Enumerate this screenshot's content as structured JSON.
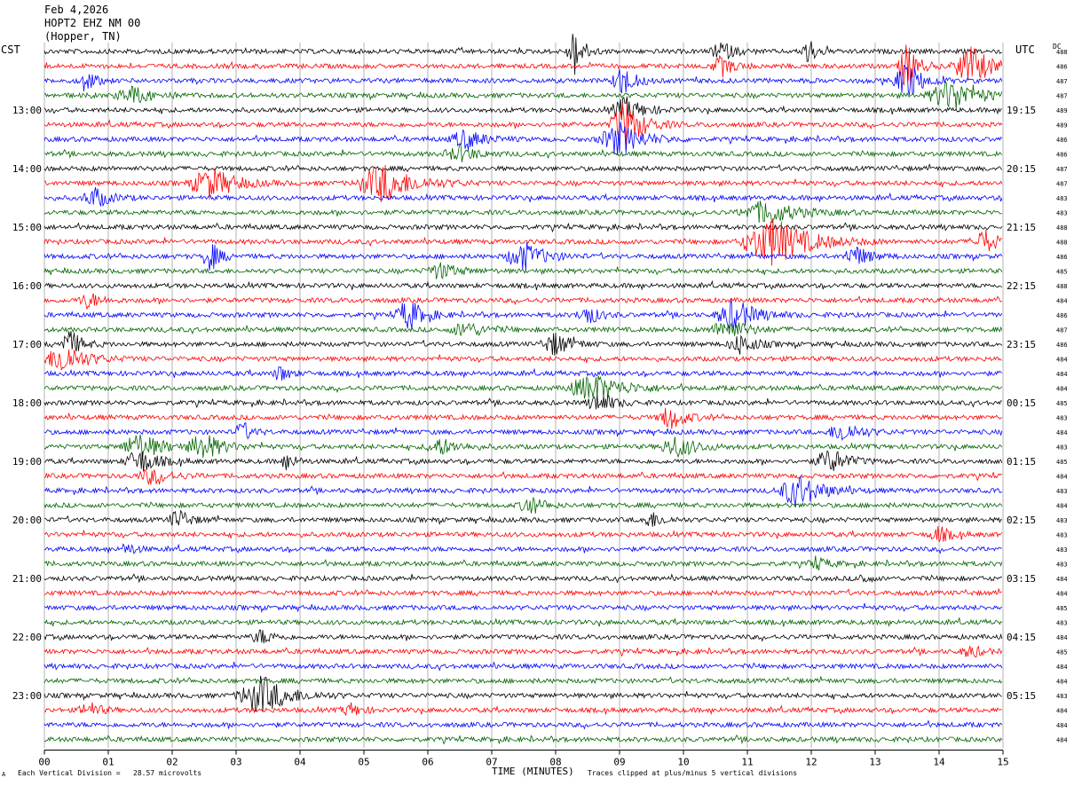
{
  "header": {
    "date": "Feb 4,2026",
    "station": "HOPT2 EHZ NM 00",
    "location": "(Hopper, TN)"
  },
  "left_tz": "CST",
  "right_tz": "UTC",
  "dc_label": "DC",
  "footer": {
    "scale_note": "Each Vertical Division =   28.57 microvolts",
    "clip_note": "Traces clipped at plus/minus 5 vertical divisions",
    "corner_mark": "A"
  },
  "colors": {
    "trace_cycle": [
      "#000000",
      "#ff0000",
      "#0000ff",
      "#006400"
    ],
    "grid": "#808080"
  },
  "chart_data": {
    "type": "line",
    "title": "Feb 4,2026",
    "xlabel": "TIME (MINUTES)",
    "ylabel": "",
    "x_range": [
      0,
      15
    ],
    "x_ticks": [
      "00",
      "01",
      "02",
      "03",
      "04",
      "05",
      "06",
      "07",
      "08",
      "09",
      "10",
      "11",
      "12",
      "13",
      "14",
      "15"
    ],
    "trace_count": 48,
    "traces_per_hour": 4,
    "minutes_per_trace": 15,
    "left_hour_labels": [
      "13:00",
      "14:00",
      "15:00",
      "16:00",
      "17:00",
      "18:00",
      "19:00",
      "20:00",
      "21:00",
      "22:00",
      "23:00"
    ],
    "right_hour_labels": [
      "19:15",
      "20:15",
      "21:15",
      "22:15",
      "23:15",
      "00:15",
      "01:15",
      "02:15",
      "03:15",
      "04:15",
      "05:15"
    ],
    "first_hour_label_trace": 4,
    "dc_offsets": [
      "488",
      "486",
      "487",
      "487",
      "489",
      "489",
      "486",
      "486",
      "487",
      "487",
      "483",
      "483",
      "488",
      "488",
      "486",
      "485",
      "488",
      "484",
      "486",
      "487",
      "486",
      "484",
      "484",
      "484",
      "485",
      "483",
      "484",
      "483",
      "485",
      "484",
      "483",
      "484",
      "483",
      "483",
      "483",
      "483",
      "484",
      "484",
      "485",
      "483",
      "484",
      "485",
      "484",
      "484",
      "483",
      "484",
      "484",
      "484"
    ],
    "events": [
      {
        "trace": 0,
        "minute": 8.3,
        "amp": 6,
        "width": 0.15
      },
      {
        "trace": 0,
        "minute": 10.6,
        "amp": 2.5,
        "width": 0.2
      },
      {
        "trace": 0,
        "minute": 11.95,
        "amp": 4,
        "width": 0.12
      },
      {
        "trace": 1,
        "minute": 10.6,
        "amp": 2.5,
        "width": 0.2
      },
      {
        "trace": 1,
        "minute": 13.5,
        "amp": 6,
        "width": 0.18
      },
      {
        "trace": 1,
        "minute": 14.5,
        "amp": 5,
        "width": 0.35
      },
      {
        "trace": 2,
        "minute": 0.65,
        "amp": 3,
        "width": 0.15
      },
      {
        "trace": 2,
        "minute": 9.05,
        "amp": 4,
        "width": 0.2
      },
      {
        "trace": 2,
        "minute": 13.5,
        "amp": 5,
        "width": 0.25
      },
      {
        "trace": 3,
        "minute": 1.4,
        "amp": 2,
        "width": 0.35
      },
      {
        "trace": 3,
        "minute": 14.2,
        "amp": 4,
        "width": 0.45
      },
      {
        "trace": 4,
        "minute": 9.1,
        "amp": 3,
        "width": 0.3
      },
      {
        "trace": 5,
        "minute": 9.1,
        "amp": 6,
        "width": 0.3
      },
      {
        "trace": 6,
        "minute": 9.0,
        "amp": 4,
        "width": 0.4
      },
      {
        "trace": 6,
        "minute": 6.6,
        "amp": 2.5,
        "width": 0.3
      },
      {
        "trace": 7,
        "minute": 6.5,
        "amp": 2,
        "width": 0.3
      },
      {
        "trace": 9,
        "minute": 2.6,
        "amp": 4,
        "width": 0.4
      },
      {
        "trace": 9,
        "minute": 5.3,
        "amp": 5,
        "width": 0.5
      },
      {
        "trace": 10,
        "minute": 0.8,
        "amp": 2.5,
        "width": 0.25
      },
      {
        "trace": 11,
        "minute": 11.3,
        "amp": 3,
        "width": 0.5
      },
      {
        "trace": 13,
        "minute": 11.4,
        "amp": 6,
        "width": 0.6
      },
      {
        "trace": 13,
        "minute": 14.7,
        "amp": 3,
        "width": 0.25
      },
      {
        "trace": 14,
        "minute": 2.6,
        "amp": 4,
        "width": 0.15
      },
      {
        "trace": 14,
        "minute": 7.5,
        "amp": 3.5,
        "width": 0.35
      },
      {
        "trace": 14,
        "minute": 12.7,
        "amp": 2.5,
        "width": 0.25
      },
      {
        "trace": 15,
        "minute": 6.2,
        "amp": 2,
        "width": 0.3
      },
      {
        "trace": 17,
        "minute": 0.7,
        "amp": 2,
        "width": 0.2
      },
      {
        "trace": 18,
        "minute": 5.7,
        "amp": 4,
        "width": 0.25
      },
      {
        "trace": 18,
        "minute": 8.5,
        "amp": 2.5,
        "width": 0.2
      },
      {
        "trace": 18,
        "minute": 10.8,
        "amp": 4,
        "width": 0.35
      },
      {
        "trace": 19,
        "minute": 6.6,
        "amp": 2,
        "width": 0.3
      },
      {
        "trace": 19,
        "minute": 10.7,
        "amp": 2.5,
        "width": 0.35
      },
      {
        "trace": 20,
        "minute": 0.4,
        "amp": 3.5,
        "width": 0.2
      },
      {
        "trace": 20,
        "minute": 8.0,
        "amp": 3,
        "width": 0.25
      },
      {
        "trace": 20,
        "minute": 10.9,
        "amp": 2.5,
        "width": 0.25
      },
      {
        "trace": 21,
        "minute": 0.3,
        "amp": 4,
        "width": 0.35
      },
      {
        "trace": 22,
        "minute": 3.7,
        "amp": 2,
        "width": 0.15
      },
      {
        "trace": 23,
        "minute": 8.6,
        "amp": 3.5,
        "width": 0.5
      },
      {
        "trace": 24,
        "minute": 8.7,
        "amp": 2.5,
        "width": 0.25
      },
      {
        "trace": 25,
        "minute": 9.8,
        "amp": 3,
        "width": 0.25
      },
      {
        "trace": 26,
        "minute": 3.1,
        "amp": 2.5,
        "width": 0.15
      },
      {
        "trace": 26,
        "minute": 12.5,
        "amp": 2.5,
        "width": 0.3
      },
      {
        "trace": 27,
        "minute": 1.5,
        "amp": 3.5,
        "width": 0.35
      },
      {
        "trace": 27,
        "minute": 2.5,
        "amp": 3.5,
        "width": 0.3
      },
      {
        "trace": 27,
        "minute": 6.2,
        "amp": 2,
        "width": 0.3
      },
      {
        "trace": 27,
        "minute": 9.9,
        "amp": 2.5,
        "width": 0.35
      },
      {
        "trace": 28,
        "minute": 1.5,
        "amp": 3,
        "width": 0.3
      },
      {
        "trace": 28,
        "minute": 3.8,
        "amp": 2,
        "width": 0.15
      },
      {
        "trace": 28,
        "minute": 12.3,
        "amp": 3,
        "width": 0.3
      },
      {
        "trace": 29,
        "minute": 1.7,
        "amp": 2,
        "width": 0.3
      },
      {
        "trace": 30,
        "minute": 11.8,
        "amp": 4,
        "width": 0.4
      },
      {
        "trace": 31,
        "minute": 7.6,
        "amp": 2.5,
        "width": 0.2
      },
      {
        "trace": 32,
        "minute": 2.1,
        "amp": 2.5,
        "width": 0.2
      },
      {
        "trace": 32,
        "minute": 9.5,
        "amp": 2,
        "width": 0.2
      },
      {
        "trace": 33,
        "minute": 14.0,
        "amp": 2,
        "width": 0.2
      },
      {
        "trace": 34,
        "minute": 1.3,
        "amp": 1.5,
        "width": 0.15
      },
      {
        "trace": 35,
        "minute": 12.1,
        "amp": 1.5,
        "width": 0.2
      },
      {
        "trace": 36,
        "minute": 12.8,
        "amp": 1.5,
        "width": 0.1
      },
      {
        "trace": 40,
        "minute": 3.4,
        "amp": 1.8,
        "width": 0.2
      },
      {
        "trace": 41,
        "minute": 14.5,
        "amp": 1.5,
        "width": 0.2
      },
      {
        "trace": 44,
        "minute": 3.4,
        "amp": 5,
        "width": 0.45
      },
      {
        "trace": 45,
        "minute": 0.7,
        "amp": 2,
        "width": 0.2
      },
      {
        "trace": 45,
        "minute": 4.8,
        "amp": 1.5,
        "width": 0.2
      }
    ]
  }
}
